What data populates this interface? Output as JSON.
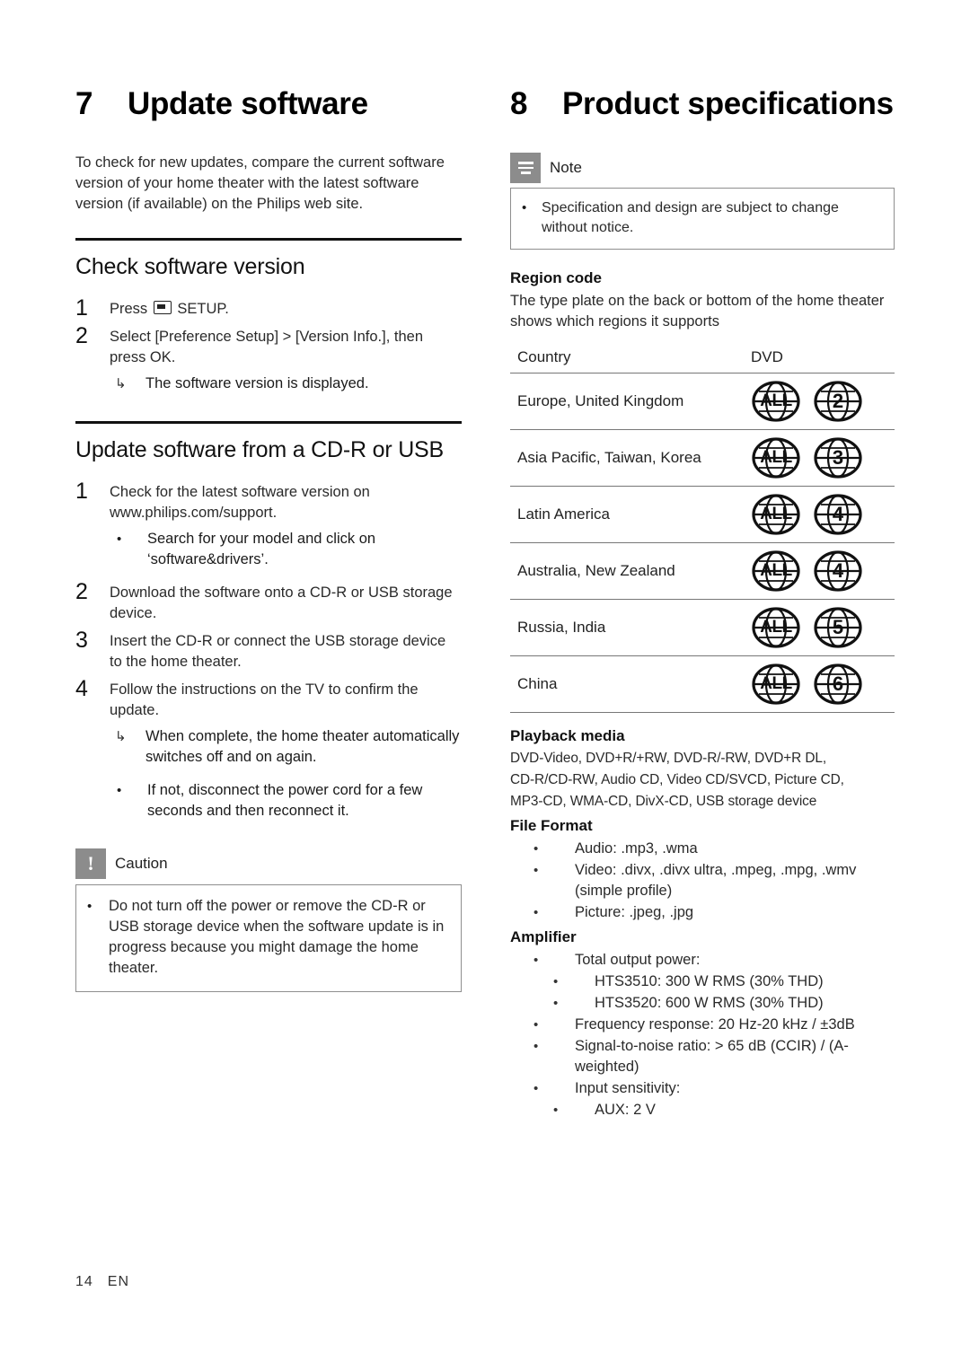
{
  "left": {
    "chapter": {
      "number": "7",
      "title": "Update software"
    },
    "intro": "To check for new updates, compare the current software version of your home theater with the latest software version (if available) on the Philips web site.",
    "section1": {
      "title": "Check software version",
      "steps": [
        {
          "n": "1",
          "text_before_icon": "Press ",
          "icon": "setup-button-icon",
          "text_after_icon": " SETUP."
        },
        {
          "n": "2",
          "text": "Select [Preference Setup] > [Version Info.], then press OK."
        }
      ],
      "arrow_note": "The software version is displayed."
    },
    "section2": {
      "title": "Update software from a CD-R or USB",
      "steps": [
        {
          "n": "1",
          "text": "Check for the latest software version on www.philips.com/support.",
          "sub": "Search for your model and click on ‘software&drivers’."
        },
        {
          "n": "2",
          "text": "Download the software onto a CD-R or USB storage device."
        },
        {
          "n": "3",
          "text": "Insert the CD-R or connect the USB storage device to the home theater."
        },
        {
          "n": "4",
          "text": "Follow the instructions on the TV to confirm the update.",
          "arrow": "When complete, the home theater automatically switches off and on again.",
          "sub": "If not, disconnect the power cord for a few seconds and then reconnect it."
        }
      ]
    },
    "caution": {
      "title": "Caution",
      "bullet": "Do not turn off the power or remove the CD-R or USB storage device when the software update is in progress because you might damage the home theater."
    }
  },
  "right": {
    "chapter": {
      "number": "8",
      "title": "Product specifications"
    },
    "note": {
      "title": "Note",
      "bullet": "Specification and design are subject to change without notice."
    },
    "region": {
      "heading": "Region code",
      "paragraph": "The type plate on the back or bottom of the home theater shows which regions it supports",
      "columns": [
        "Country",
        "DVD"
      ],
      "rows": [
        {
          "country": "Europe, United Kingdom",
          "codes": [
            "ALL",
            "2"
          ]
        },
        {
          "country": "Asia Pacific, Taiwan, Korea",
          "codes": [
            "ALL",
            "3"
          ]
        },
        {
          "country": "Latin America",
          "codes": [
            "ALL",
            "4"
          ]
        },
        {
          "country": "Australia, New Zealand",
          "codes": [
            "ALL",
            "4"
          ]
        },
        {
          "country": "Russia, India",
          "codes": [
            "ALL",
            "5"
          ]
        },
        {
          "country": "China",
          "codes": [
            "ALL",
            "6"
          ]
        }
      ]
    },
    "playback": {
      "heading": "Playback media",
      "line1": "DVD-Video, DVD+R/+RW, DVD-R/-RW, DVD+R DL,",
      "line2": "CD-R/CD-RW, Audio CD, Video CD/SVCD, Picture CD,",
      "line3": "MP3-CD, WMA-CD, DivX-CD, USB storage device"
    },
    "file_format": {
      "heading": "File Format",
      "items": [
        "Audio: .mp3, .wma",
        "Video: .divx, .divx ultra, .mpeg, .mpg, .wmv (simple profile)",
        "Picture: .jpeg, .jpg"
      ]
    },
    "amplifier": {
      "heading": "Amplifier",
      "items": [
        {
          "text": "Total output power:",
          "level": 1
        },
        {
          "text": "HTS3510: 300 W RMS (30% THD)",
          "level": 2
        },
        {
          "text": "HTS3520: 600 W RMS (30% THD)",
          "level": 2
        },
        {
          "text": "Frequency response: 20 Hz-20 kHz / ±3dB",
          "level": 1
        },
        {
          "text": "Signal-to-noise ratio: > 65 dB (CCIR) / (A-weighted)",
          "level": 1
        },
        {
          "text": "Input sensitivity:",
          "level": 1
        },
        {
          "text": "AUX: 2 V",
          "level": 2
        }
      ]
    }
  },
  "footer": {
    "page": "14",
    "lang": "EN"
  }
}
